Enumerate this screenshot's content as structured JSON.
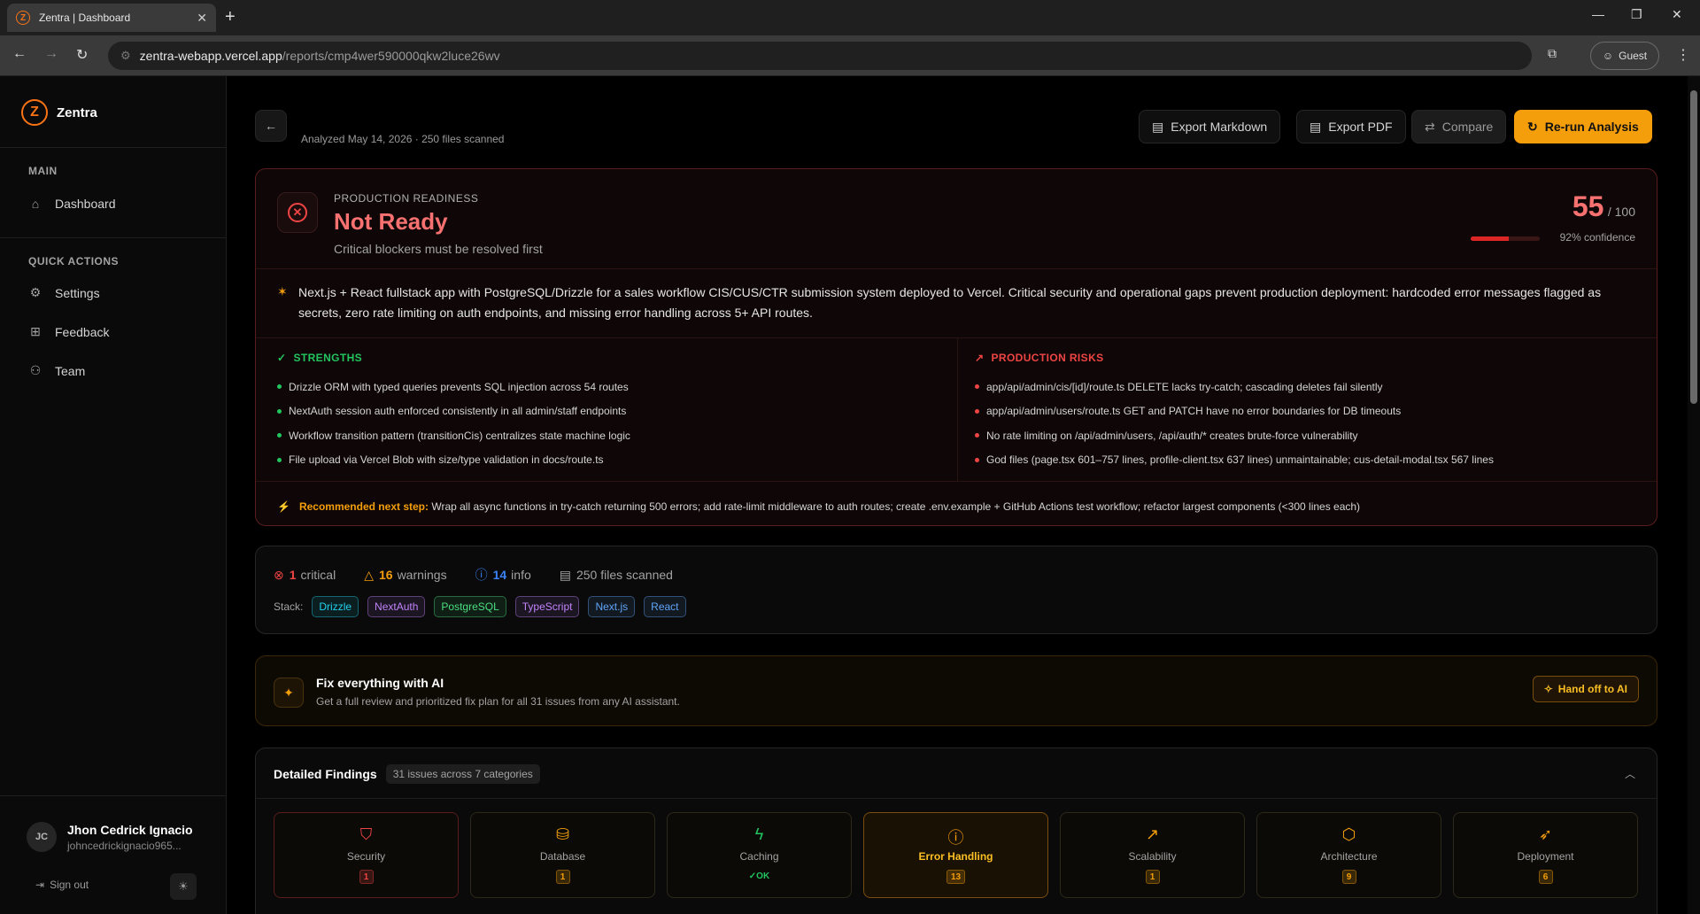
{
  "browser": {
    "tab_title": "Zentra | Dashboard",
    "url_host": "zentra-webapp.vercel.app",
    "url_path": "/reports/cmp4wer590000qkw2luce26wv",
    "profile": "Guest"
  },
  "sidebar": {
    "brand": "Zentra",
    "main_label": "MAIN",
    "dashboard": "Dashboard",
    "quick_label": "QUICK ACTIONS",
    "settings": "Settings",
    "feedback": "Feedback",
    "team": "Team",
    "user_initials": "JC",
    "user_name": "Jhon Cedrick Ignacio",
    "user_email": "johncedrickignacio965...",
    "signout": "Sign out"
  },
  "toolbar": {
    "analyzed": "Analyzed May 14, 2026 · 250 files scanned",
    "export_md": "Export Markdown",
    "export_pdf": "Export PDF",
    "compare": "Compare",
    "rerun": "Re-run Analysis"
  },
  "readiness": {
    "label": "PRODUCTION READINESS",
    "status": "Not Ready",
    "subtitle": "Critical blockers must be resolved first",
    "score": "55",
    "score_max": "/ 100",
    "score_fraction": 0.55,
    "confidence": "92% confidence",
    "summary": "Next.js + React fullstack app with PostgreSQL/Drizzle for a sales workflow CIS/CUS/CTR submission system deployed to Vercel. Critical security and operational gaps prevent production deployment: hardcoded error messages flagged as secrets, zero rate limiting on auth endpoints, and missing error handling across 5+ API routes.",
    "strengths_label": "STRENGTHS",
    "strengths": [
      "Drizzle ORM with typed queries prevents SQL injection across 54 routes",
      "NextAuth session auth enforced consistently in all admin/staff endpoints",
      "Workflow transition pattern (transitionCis) centralizes state machine logic",
      "File upload via Vercel Blob with size/type validation in docs/route.ts"
    ],
    "risks_label": "PRODUCTION RISKS",
    "risks": [
      "app/api/admin/cis/[id]/route.ts DELETE lacks try-catch; cascading deletes fail silently",
      "app/api/admin/users/route.ts GET and PATCH have no error boundaries for DB timeouts",
      "No rate limiting on /api/admin/users, /api/auth/* creates brute-force vulnerability",
      "God files (page.tsx 601–757 lines, profile-client.tsx 637 lines) unmaintainable; cus-detail-modal.tsx 567 lines"
    ],
    "next_step_label": "Recommended next step:",
    "next_step": "Wrap all async functions in try-catch returning 500 errors; add rate-limit middleware to auth routes; create .env.example + GitHub Actions test workflow; refactor largest components (<300 lines each)"
  },
  "stats": {
    "critical_n": "1",
    "critical_l": "critical",
    "warnings_n": "16",
    "warnings_l": "warnings",
    "info_n": "14",
    "info_l": "info",
    "files": "250 files scanned",
    "stack_label": "Stack:",
    "stack": [
      "Drizzle",
      "NextAuth",
      "PostgreSQL",
      "TypeScript",
      "Next.js",
      "React"
    ],
    "stack_colors": [
      "#22d3ee",
      "#c084fc",
      "#4ade80",
      "#c084fc",
      "#60a5fa",
      "#60a5fa"
    ]
  },
  "ai": {
    "title": "Fix everything with AI",
    "subtitle": "Get a full review and prioritized fix plan for all 31 issues from any AI assistant.",
    "button": "Hand off to AI"
  },
  "findings": {
    "title": "Detailed Findings",
    "count": "31 issues across 7 categories",
    "categories": [
      {
        "name": "Security",
        "count": "1",
        "icon": "shield-icon",
        "color": "#ef4444"
      },
      {
        "name": "Database",
        "count": "1",
        "icon": "database-icon",
        "color": "#f59e0b"
      },
      {
        "name": "Caching",
        "count": "OK",
        "icon": "bolt-icon",
        "color": "#22c55e"
      },
      {
        "name": "Error Handling",
        "count": "13",
        "icon": "alert-circle-icon",
        "color": "#f59e0b"
      },
      {
        "name": "Scalability",
        "count": "1",
        "icon": "trend-up-icon",
        "color": "#f59e0b"
      },
      {
        "name": "Architecture",
        "count": "9",
        "icon": "cube-icon",
        "color": "#f59e0b"
      },
      {
        "name": "Deployment",
        "count": "6",
        "icon": "rocket-icon",
        "color": "#f59e0b"
      }
    ]
  }
}
